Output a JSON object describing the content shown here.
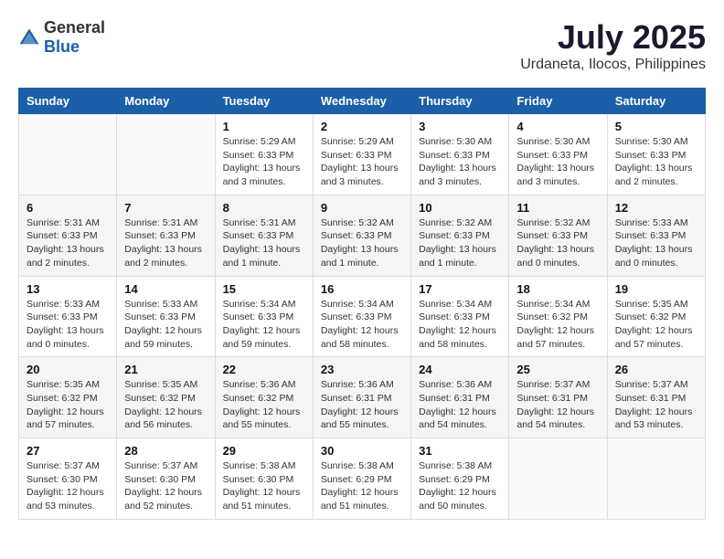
{
  "header": {
    "logo_general": "General",
    "logo_blue": "Blue",
    "month_year": "July 2025",
    "location": "Urdaneta, Ilocos, Philippines"
  },
  "weekdays": [
    "Sunday",
    "Monday",
    "Tuesday",
    "Wednesday",
    "Thursday",
    "Friday",
    "Saturday"
  ],
  "weeks": [
    [
      {
        "day": "",
        "info": ""
      },
      {
        "day": "",
        "info": ""
      },
      {
        "day": "1",
        "info": "Sunrise: 5:29 AM\nSunset: 6:33 PM\nDaylight: 13 hours and 3 minutes."
      },
      {
        "day": "2",
        "info": "Sunrise: 5:29 AM\nSunset: 6:33 PM\nDaylight: 13 hours and 3 minutes."
      },
      {
        "day": "3",
        "info": "Sunrise: 5:30 AM\nSunset: 6:33 PM\nDaylight: 13 hours and 3 minutes."
      },
      {
        "day": "4",
        "info": "Sunrise: 5:30 AM\nSunset: 6:33 PM\nDaylight: 13 hours and 3 minutes."
      },
      {
        "day": "5",
        "info": "Sunrise: 5:30 AM\nSunset: 6:33 PM\nDaylight: 13 hours and 2 minutes."
      }
    ],
    [
      {
        "day": "6",
        "info": "Sunrise: 5:31 AM\nSunset: 6:33 PM\nDaylight: 13 hours and 2 minutes."
      },
      {
        "day": "7",
        "info": "Sunrise: 5:31 AM\nSunset: 6:33 PM\nDaylight: 13 hours and 2 minutes."
      },
      {
        "day": "8",
        "info": "Sunrise: 5:31 AM\nSunset: 6:33 PM\nDaylight: 13 hours and 1 minute."
      },
      {
        "day": "9",
        "info": "Sunrise: 5:32 AM\nSunset: 6:33 PM\nDaylight: 13 hours and 1 minute."
      },
      {
        "day": "10",
        "info": "Sunrise: 5:32 AM\nSunset: 6:33 PM\nDaylight: 13 hours and 1 minute."
      },
      {
        "day": "11",
        "info": "Sunrise: 5:32 AM\nSunset: 6:33 PM\nDaylight: 13 hours and 0 minutes."
      },
      {
        "day": "12",
        "info": "Sunrise: 5:33 AM\nSunset: 6:33 PM\nDaylight: 13 hours and 0 minutes."
      }
    ],
    [
      {
        "day": "13",
        "info": "Sunrise: 5:33 AM\nSunset: 6:33 PM\nDaylight: 13 hours and 0 minutes."
      },
      {
        "day": "14",
        "info": "Sunrise: 5:33 AM\nSunset: 6:33 PM\nDaylight: 12 hours and 59 minutes."
      },
      {
        "day": "15",
        "info": "Sunrise: 5:34 AM\nSunset: 6:33 PM\nDaylight: 12 hours and 59 minutes."
      },
      {
        "day": "16",
        "info": "Sunrise: 5:34 AM\nSunset: 6:33 PM\nDaylight: 12 hours and 58 minutes."
      },
      {
        "day": "17",
        "info": "Sunrise: 5:34 AM\nSunset: 6:33 PM\nDaylight: 12 hours and 58 minutes."
      },
      {
        "day": "18",
        "info": "Sunrise: 5:34 AM\nSunset: 6:32 PM\nDaylight: 12 hours and 57 minutes."
      },
      {
        "day": "19",
        "info": "Sunrise: 5:35 AM\nSunset: 6:32 PM\nDaylight: 12 hours and 57 minutes."
      }
    ],
    [
      {
        "day": "20",
        "info": "Sunrise: 5:35 AM\nSunset: 6:32 PM\nDaylight: 12 hours and 57 minutes."
      },
      {
        "day": "21",
        "info": "Sunrise: 5:35 AM\nSunset: 6:32 PM\nDaylight: 12 hours and 56 minutes."
      },
      {
        "day": "22",
        "info": "Sunrise: 5:36 AM\nSunset: 6:32 PM\nDaylight: 12 hours and 55 minutes."
      },
      {
        "day": "23",
        "info": "Sunrise: 5:36 AM\nSunset: 6:31 PM\nDaylight: 12 hours and 55 minutes."
      },
      {
        "day": "24",
        "info": "Sunrise: 5:36 AM\nSunset: 6:31 PM\nDaylight: 12 hours and 54 minutes."
      },
      {
        "day": "25",
        "info": "Sunrise: 5:37 AM\nSunset: 6:31 PM\nDaylight: 12 hours and 54 minutes."
      },
      {
        "day": "26",
        "info": "Sunrise: 5:37 AM\nSunset: 6:31 PM\nDaylight: 12 hours and 53 minutes."
      }
    ],
    [
      {
        "day": "27",
        "info": "Sunrise: 5:37 AM\nSunset: 6:30 PM\nDaylight: 12 hours and 53 minutes."
      },
      {
        "day": "28",
        "info": "Sunrise: 5:37 AM\nSunset: 6:30 PM\nDaylight: 12 hours and 52 minutes."
      },
      {
        "day": "29",
        "info": "Sunrise: 5:38 AM\nSunset: 6:30 PM\nDaylight: 12 hours and 51 minutes."
      },
      {
        "day": "30",
        "info": "Sunrise: 5:38 AM\nSunset: 6:29 PM\nDaylight: 12 hours and 51 minutes."
      },
      {
        "day": "31",
        "info": "Sunrise: 5:38 AM\nSunset: 6:29 PM\nDaylight: 12 hours and 50 minutes."
      },
      {
        "day": "",
        "info": ""
      },
      {
        "day": "",
        "info": ""
      }
    ]
  ]
}
